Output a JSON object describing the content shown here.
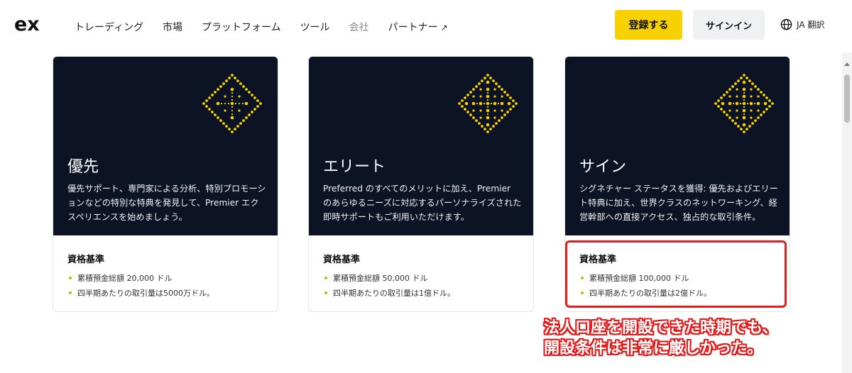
{
  "header": {
    "logo_text": "ex",
    "nav": [
      {
        "label": "トレーディング",
        "muted": false,
        "external": false
      },
      {
        "label": "市場",
        "muted": false,
        "external": false
      },
      {
        "label": "プラットフォーム",
        "muted": false,
        "external": false
      },
      {
        "label": "ツール",
        "muted": false,
        "external": false
      },
      {
        "label": "会社",
        "muted": true,
        "external": false
      },
      {
        "label": "パートナー",
        "muted": false,
        "external": true
      }
    ],
    "external_icon": "↗",
    "register_label": "登録する",
    "signin_label": "サインイン",
    "lang_code": "JA",
    "translate_label": "翻訳",
    "lang_icon": "globe-icon"
  },
  "cards": [
    {
      "title": "優先",
      "description": "優先サポート、専門家による分析、特別プロモーションなどの特別な特典を発見して、Premier エクスペリエンスを始めましょう。",
      "criteria_title": "資格基準",
      "criteria": [
        "累積預金総額 20,000 ドル",
        "四半期あたりの取引量は5000万ドル。"
      ]
    },
    {
      "title": "エリート",
      "description": "Preferred のすべてのメリットに加え、Premier のあらゆるニーズに対応するパーソナライズされた即時サポートもご利用いただけます。",
      "criteria_title": "資格基準",
      "criteria": [
        "累積預金総額 50,000 ドル",
        "四半期あたりの取引量は1億ドル。"
      ]
    },
    {
      "title": "サイン",
      "description": "シグネチャー ステータスを獲得: 優先およびエリート特典に加え、世界クラスのネットワーキング、経営幹部への直接アクセス、独占的な取引条件。",
      "criteria_title": "資格基準",
      "criteria": [
        "累積預金総額 100,000 ドル",
        "四半期あたりの取引量は2億ドル。"
      ]
    }
  ],
  "annotation": {
    "line1": "法人口座を開設できた時期でも、",
    "line2": "開設条件は非常に厳しかった。"
  },
  "colors": {
    "accent": "#f7d104",
    "card_dark": "#0b1324",
    "annotation_red": "#e21b1b"
  }
}
